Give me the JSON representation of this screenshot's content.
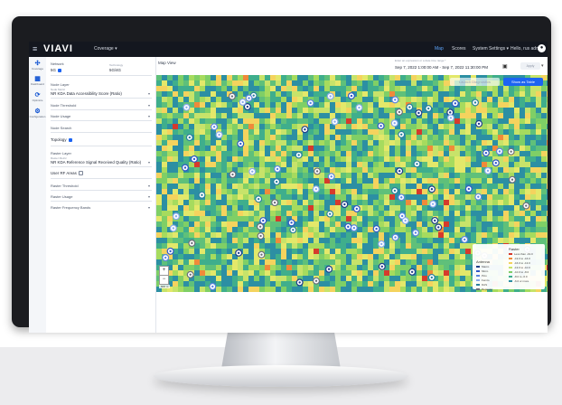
{
  "header": {
    "logo": "VIAVI",
    "app_selector": "Coverage",
    "nav": [
      "Map",
      "Scores",
      "System Settings",
      "Hello, rus admin"
    ],
    "user_icon": "user-circle-icon"
  },
  "rail": {
    "items": [
      {
        "icon": "coverage-icon",
        "label": "Coverage"
      },
      {
        "icon": "dashboard-icon",
        "label": "Dashboard"
      },
      {
        "icon": "optimize-icon",
        "label": "Optimize"
      },
      {
        "icon": "settings-icon",
        "label": "Configuration"
      }
    ]
  },
  "panel": {
    "network_label": "Network",
    "network_value": "5G",
    "technology_label": "Technology",
    "technology_value": "5G/4G",
    "node_layer_label": "Node Layer",
    "node_metric_small": "Node Metric",
    "node_metric_value": "NR KDA Data Accessibility Score (Ratio)",
    "node_threshold": "Node Threshold",
    "node_usage": "Node Usage",
    "node_search": "Node Search",
    "topology": "Topology",
    "raster_layer_label": "Raster Layer",
    "raster_metric_small": "Raster Metric",
    "raster_metric_value": "NR KDA Reference Signal Received Quality (Ratio)",
    "user_rf_areas": "User RF Areas",
    "raster_threshold": "Raster Threshold",
    "raster_usage": "Raster Usage",
    "raster_frequency": "Raster Frequency Bands"
  },
  "main": {
    "title": "Map View",
    "time_label": "Enter an expression or a date time range *",
    "time_value": "Sep 7, 2022 1:00:00 AM - Sep 7, 2022 11:30:00 PM",
    "apply": "Apply",
    "launch_diagnostics": "Launch Diagnostics",
    "show_as_table": "Show as Table",
    "zoom_in": "+",
    "zoom_out": "−",
    "scale": "500 m"
  },
  "legend": {
    "antenna_title": "Antenna",
    "antenna_items": [
      {
        "label": "Macro",
        "color": "#1f3d8a"
      },
      {
        "label": "Micro",
        "color": "#3058c7"
      },
      {
        "label": "Pico",
        "color": "#5c84e0"
      },
      {
        "label": "Femto",
        "color": "#8aa9ec"
      },
      {
        "label": "DAS",
        "color": "#2a7f9e"
      },
      {
        "label": "Repeater",
        "color": "#6c6f7a"
      }
    ],
    "raster_title": "Raster",
    "raster_items": [
      {
        "label": "Less than -19.0",
        "color": "#d63a2c"
      },
      {
        "label": "-19.0 to -16.0",
        "color": "#f08a3a"
      },
      {
        "label": "-16.0 to -13.0",
        "color": "#f4d35e"
      },
      {
        "label": "-13.0 to -10.0",
        "color": "#c7e36a"
      },
      {
        "label": "-10.0 to -8.0",
        "color": "#7fcf66"
      },
      {
        "label": "-8.0 to -6.0",
        "color": "#3fae8c"
      },
      {
        "label": "-6.0 or more",
        "color": "#2c8fa3"
      }
    ]
  },
  "colors": {
    "topbar": "#14171f",
    "accent": "#1c64f2",
    "heat": [
      "#2c8fa3",
      "#3fae8c",
      "#5fc07a",
      "#7fcf66",
      "#a6db5e",
      "#c7e36a",
      "#e3e86a",
      "#f4d35e",
      "#f08a3a",
      "#d63a2c"
    ]
  }
}
